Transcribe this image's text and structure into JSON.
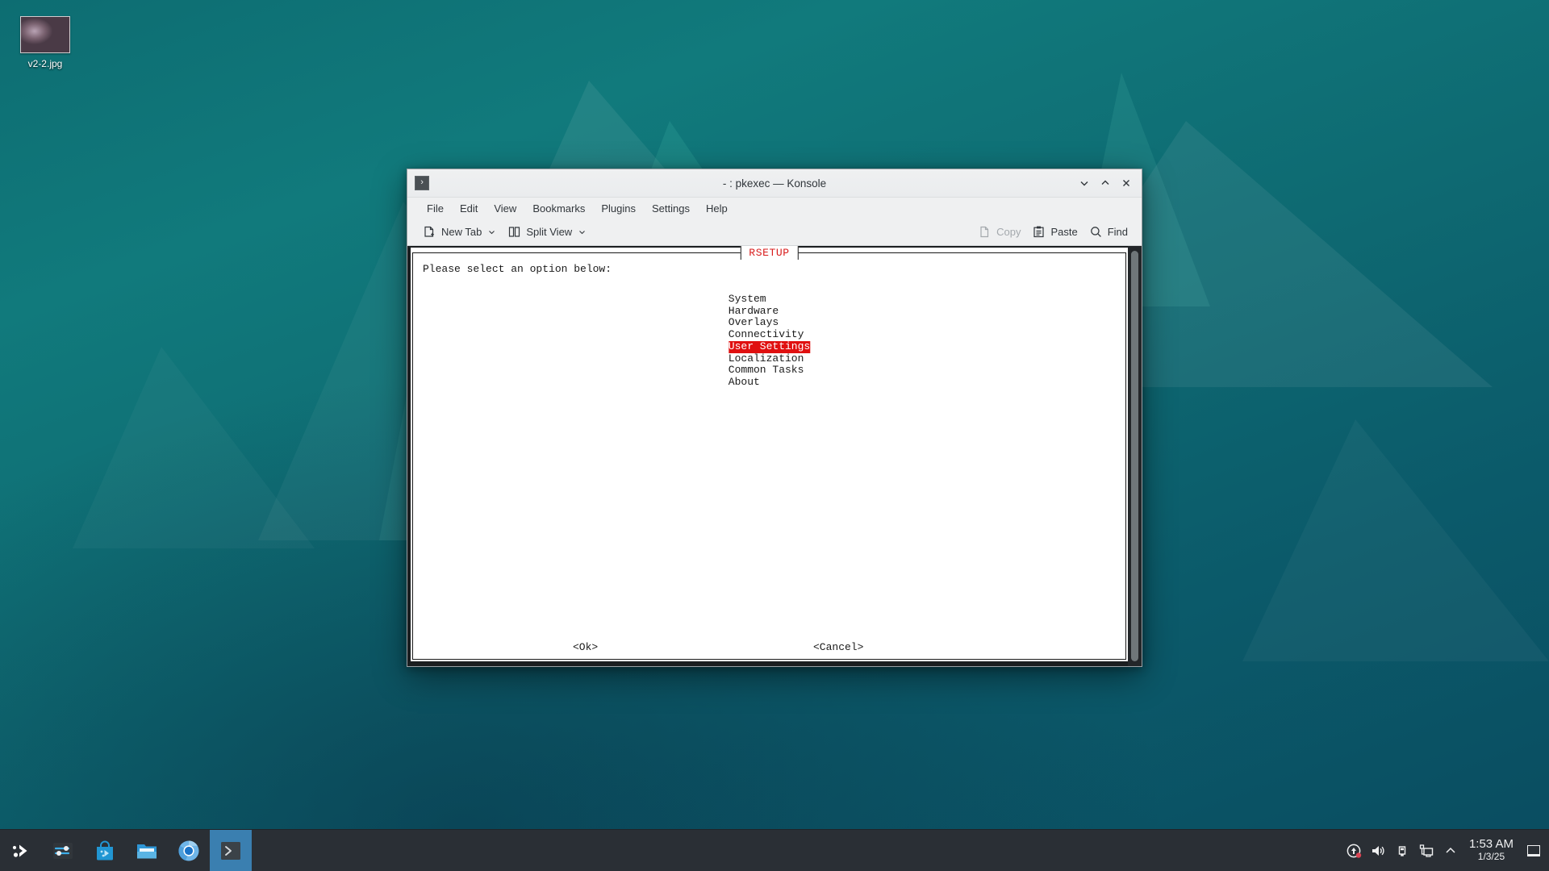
{
  "desktop": {
    "icon": {
      "label": "v2-2.jpg",
      "icon_name": "image-thumbnail"
    },
    "wallpaper_colors": {
      "top": "#117a7c",
      "bottom": "#0a4c60",
      "accent": "#0d6d72"
    }
  },
  "window": {
    "title": "- : pkexec — Konsole",
    "app_icon": "›",
    "controls": [
      {
        "name": "minimize",
        "glyph": "chevron-down-icon"
      },
      {
        "name": "maximize",
        "glyph": "chevron-up-icon"
      },
      {
        "name": "close",
        "glyph": "close-icon"
      }
    ],
    "menubar": [
      "File",
      "Edit",
      "View",
      "Bookmarks",
      "Plugins",
      "Settings",
      "Help"
    ],
    "toolbar": {
      "left": [
        {
          "label": "New Tab",
          "icon": "new-tab-icon",
          "has_dropdown": true,
          "disabled": false
        },
        {
          "label": "Split View",
          "icon": "split-view-icon",
          "has_dropdown": true,
          "disabled": false
        }
      ],
      "right": [
        {
          "label": "Copy",
          "icon": "copy-icon",
          "disabled": true
        },
        {
          "label": "Paste",
          "icon": "paste-icon",
          "disabled": false
        },
        {
          "label": "Find",
          "icon": "search-icon",
          "disabled": false
        }
      ]
    }
  },
  "dialog": {
    "title": "RSETUP",
    "title_color": "#d81c1c",
    "prompt": "Please select an option below:",
    "selected_index": 4,
    "selection_bg": "#e01010",
    "selection_fg": "#ffffff",
    "items": [
      "System",
      "Hardware",
      "Overlays",
      "Connectivity",
      "User Settings",
      "Localization",
      "Common Tasks",
      "About"
    ],
    "buttons": {
      "ok": "<Ok>",
      "cancel": "<Cancel>"
    }
  },
  "taskbar": {
    "launcher": {
      "name": "kde-launcher-icon"
    },
    "pinned": [
      {
        "name": "system-settings-icon"
      },
      {
        "name": "discover-store-icon"
      },
      {
        "name": "file-manager-icon"
      },
      {
        "name": "chromium-browser-icon"
      },
      {
        "name": "konsole-icon",
        "active": true
      }
    ],
    "tray": [
      {
        "name": "updates-icon",
        "badge": true
      },
      {
        "name": "volume-icon"
      },
      {
        "name": "usb-drive-icon"
      },
      {
        "name": "network-display-icon"
      },
      {
        "name": "show-hidden-tray-icon"
      }
    ],
    "clock": {
      "time": "1:53 AM",
      "date": "1/3/25"
    },
    "show_desktop": {
      "name": "show-desktop-button"
    }
  }
}
